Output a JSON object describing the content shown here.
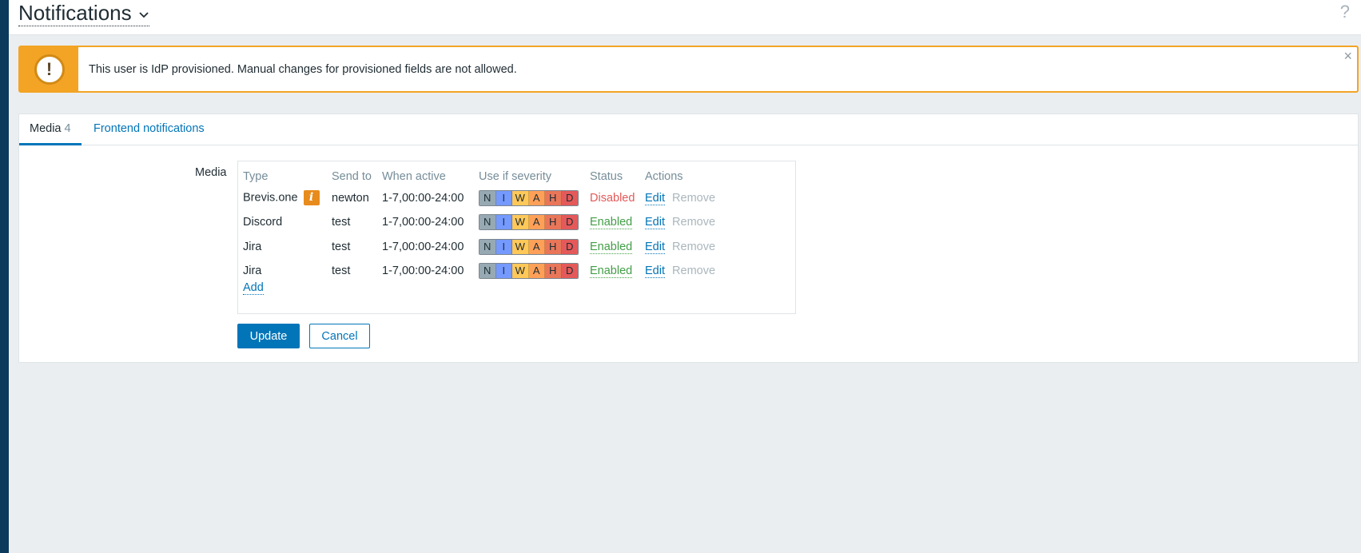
{
  "header": {
    "title": "Notifications",
    "help_glyph": "?"
  },
  "alert": {
    "icon_glyph": "!",
    "message": "This user is IdP provisioned. Manual changes for provisioned fields are not allowed.",
    "close_glyph": "×",
    "accent_color": "#f3a425"
  },
  "tabs": [
    {
      "label": "Media",
      "count": "4",
      "active": true
    },
    {
      "label": "Frontend notifications",
      "active": false
    }
  ],
  "form": {
    "media_label": "Media",
    "columns": [
      "Type",
      "Send to",
      "When active",
      "Use if severity",
      "Status",
      "Actions"
    ],
    "rows": [
      {
        "type": "Brevis.one",
        "info_badge": "i",
        "send_to": "newton",
        "when_active": "1-7,00:00-24:00",
        "status": "Disabled",
        "edit": "Edit",
        "remove": "Remove"
      },
      {
        "type": "Discord",
        "send_to": "test",
        "when_active": "1-7,00:00-24:00",
        "status": "Enabled",
        "edit": "Edit",
        "remove": "Remove"
      },
      {
        "type": "Jira",
        "send_to": "test",
        "when_active": "1-7,00:00-24:00",
        "status": "Enabled",
        "edit": "Edit",
        "remove": "Remove"
      },
      {
        "type": "Jira",
        "send_to": "test",
        "when_active": "1-7,00:00-24:00",
        "status": "Enabled",
        "edit": "Edit",
        "remove": "Remove"
      }
    ],
    "severity_letters": [
      "N",
      "I",
      "W",
      "A",
      "H",
      "D"
    ],
    "severity_colors": {
      "N": "#97aab3",
      "I": "#7499ff",
      "W": "#ffc859",
      "A": "#ffa059",
      "H": "#e97659",
      "D": "#e45959"
    },
    "add_label": "Add",
    "update_label": "Update",
    "cancel_label": "Cancel"
  }
}
